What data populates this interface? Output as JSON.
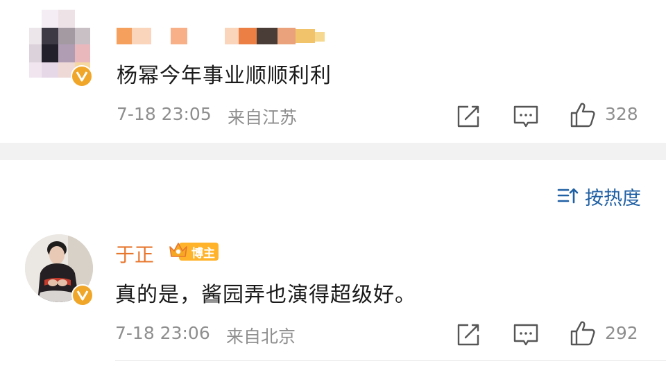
{
  "comments": [
    {
      "text": "杨幂今年事业顺顺利利",
      "time": "7-18 23:05",
      "location": "来自江苏",
      "likes": "328"
    },
    {
      "author": "于正",
      "badge": "博主",
      "text": "真的是，酱园弄也演得超级好。",
      "time": "7-18 23:06",
      "location": "来自北京",
      "likes": "292"
    }
  ],
  "sort": {
    "label": "按热度"
  },
  "icons": {
    "share": "share-icon",
    "comment": "comment-icon",
    "like": "thumbs-up-icon",
    "verified": "verified-v-icon",
    "sort": "sort-icon",
    "crown": "crown-icon"
  },
  "colors": {
    "author_name": "#e8772e",
    "sort_link": "#1f5fa3",
    "verified_badge": "#f0a629",
    "meta_text": "#8e8e8e",
    "separator": "#f2f2f2"
  }
}
